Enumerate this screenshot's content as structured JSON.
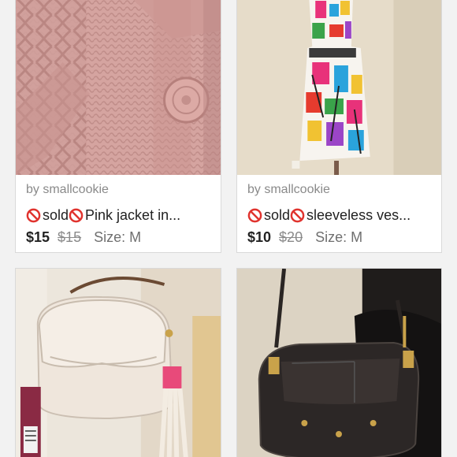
{
  "listings": [
    {
      "seller": "by smallcookie",
      "status": "sold",
      "title": "Pink jacket  in...",
      "price": "$15",
      "original_price": "$15",
      "size": "Size: M",
      "image_icon": "knit-jacket-photo"
    },
    {
      "seller": "by smallcookie",
      "status": "sold",
      "title": "sleeveless ves...",
      "price": "$10",
      "original_price": "$20",
      "size": "Size: M",
      "image_icon": "print-dress-photo"
    },
    {
      "image_icon": "white-bag-photo"
    },
    {
      "image_icon": "black-bag-photo"
    }
  ],
  "colors": {
    "sold_icon": "#e0332e",
    "page_bg": "#f2f2f2",
    "card_border": "#d9d9d9"
  }
}
